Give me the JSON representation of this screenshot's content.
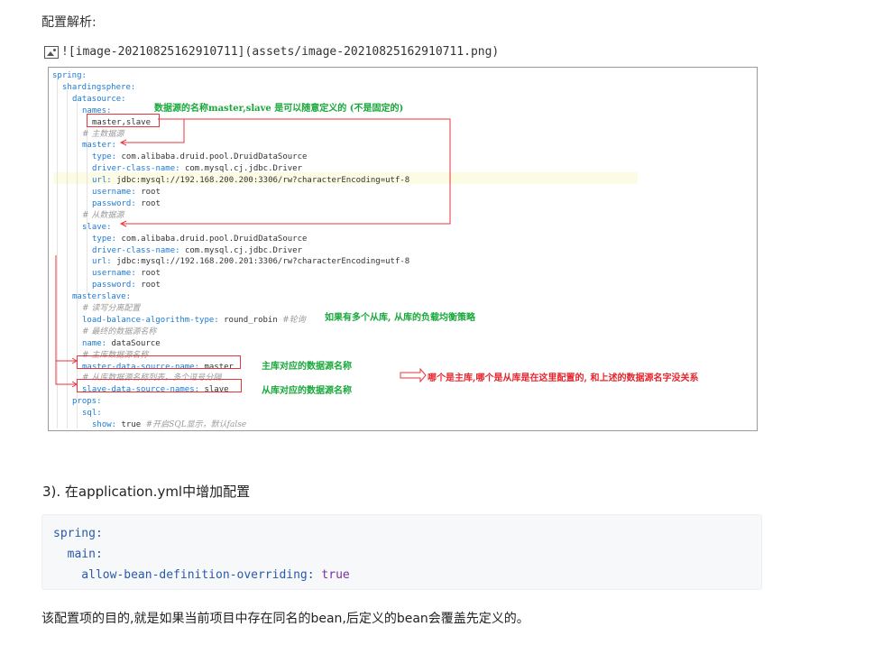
{
  "heading": "配置解析:",
  "image_ref": "![image-20210825162910711](assets/image-20210825162910711.png)",
  "screenshot": {
    "yaml_lines": [
      {
        "indent": 0,
        "key": "spring:",
        "value": "",
        "comment": ""
      },
      {
        "indent": 1,
        "key": "shardingsphere:",
        "value": "",
        "comment": ""
      },
      {
        "indent": 2,
        "key": "datasource:",
        "value": "",
        "comment": ""
      },
      {
        "indent": 3,
        "key": "names:",
        "value": "",
        "comment": ""
      },
      {
        "indent": 4,
        "key": "",
        "value": "master,slave",
        "comment": ""
      },
      {
        "indent": 3,
        "key": "",
        "value": "",
        "comment": "# 主数据源"
      },
      {
        "indent": 3,
        "key": "master:",
        "value": "",
        "comment": ""
      },
      {
        "indent": 4,
        "key": "type:",
        "value": " com.alibaba.druid.pool.DruidDataSource",
        "comment": ""
      },
      {
        "indent": 4,
        "key": "driver-class-name:",
        "value": " com.mysql.cj.jdbc.Driver",
        "comment": ""
      },
      {
        "indent": 4,
        "key": "url:",
        "value": " jdbc:mysql://192.168.200.200:3306/rw?characterEncoding=utf-8",
        "comment": ""
      },
      {
        "indent": 4,
        "key": "username:",
        "value": " root",
        "comment": ""
      },
      {
        "indent": 4,
        "key": "password:",
        "value": " root",
        "comment": ""
      },
      {
        "indent": 3,
        "key": "",
        "value": "",
        "comment": "# 从数据源"
      },
      {
        "indent": 3,
        "key": "slave:",
        "value": "",
        "comment": ""
      },
      {
        "indent": 4,
        "key": "type:",
        "value": " com.alibaba.druid.pool.DruidDataSource",
        "comment": ""
      },
      {
        "indent": 4,
        "key": "driver-class-name:",
        "value": " com.mysql.cj.jdbc.Driver",
        "comment": ""
      },
      {
        "indent": 4,
        "key": "url:",
        "value": " jdbc:mysql://192.168.200.201:3306/rw?characterEncoding=utf-8",
        "comment": ""
      },
      {
        "indent": 4,
        "key": "username:",
        "value": " root",
        "comment": ""
      },
      {
        "indent": 4,
        "key": "password:",
        "value": " root",
        "comment": ""
      },
      {
        "indent": 2,
        "key": "masterslave:",
        "value": "",
        "comment": ""
      },
      {
        "indent": 3,
        "key": "",
        "value": "",
        "comment": "# 读写分离配置"
      },
      {
        "indent": 3,
        "key": "load-balance-algorithm-type:",
        "value": " round_robin ",
        "comment": "#轮询"
      },
      {
        "indent": 3,
        "key": "",
        "value": "",
        "comment": "# 最终的数据源名称"
      },
      {
        "indent": 3,
        "key": "name:",
        "value": " dataSource",
        "comment": ""
      },
      {
        "indent": 3,
        "key": "",
        "value": "",
        "comment": "# 主库数据源名称"
      },
      {
        "indent": 3,
        "key": "master-data-source-name:",
        "value": " master",
        "comment": ""
      },
      {
        "indent": 3,
        "key": "",
        "value": "",
        "comment": "# 从库数据源名称列表，多个逗号分隔"
      },
      {
        "indent": 3,
        "key": "slave-data-source-names:",
        "value": " slave",
        "comment": ""
      },
      {
        "indent": 2,
        "key": "props:",
        "value": "",
        "comment": ""
      },
      {
        "indent": 3,
        "key": "sql:",
        "value": "",
        "comment": ""
      },
      {
        "indent": 4,
        "key": "show:",
        "value": " true ",
        "comment": "#开启SQL显示，默认false"
      }
    ],
    "annotations": {
      "names_note": "数据源的名称master,slave 是可以随意定义的 (不是固定的)",
      "lb_note": "如果有多个从库, 从库的负载均衡策略",
      "master_note": "主库对应的数据源名称",
      "slave_note": "从库对应的数据源名称",
      "relation_note": "哪个是主库,哪个是从库是在这里配置的, 和上述的数据源名字没关系"
    },
    "colors": {
      "key": "#1c7ad6",
      "annotation_green": "#18a83a",
      "annotation_red": "#e8252d"
    }
  },
  "section_title": "3). 在application.yml中增加配置",
  "code_block": [
    {
      "indent": "",
      "key": "spring:",
      "value": ""
    },
    {
      "indent": "  ",
      "key": "main:",
      "value": ""
    },
    {
      "indent": "    ",
      "key": "allow-bean-definition-overriding:",
      "value": " true"
    }
  ],
  "footer_text": "该配置项的目的,就是如果当前项目中存在同名的bean,后定义的bean会覆盖先定义的。"
}
